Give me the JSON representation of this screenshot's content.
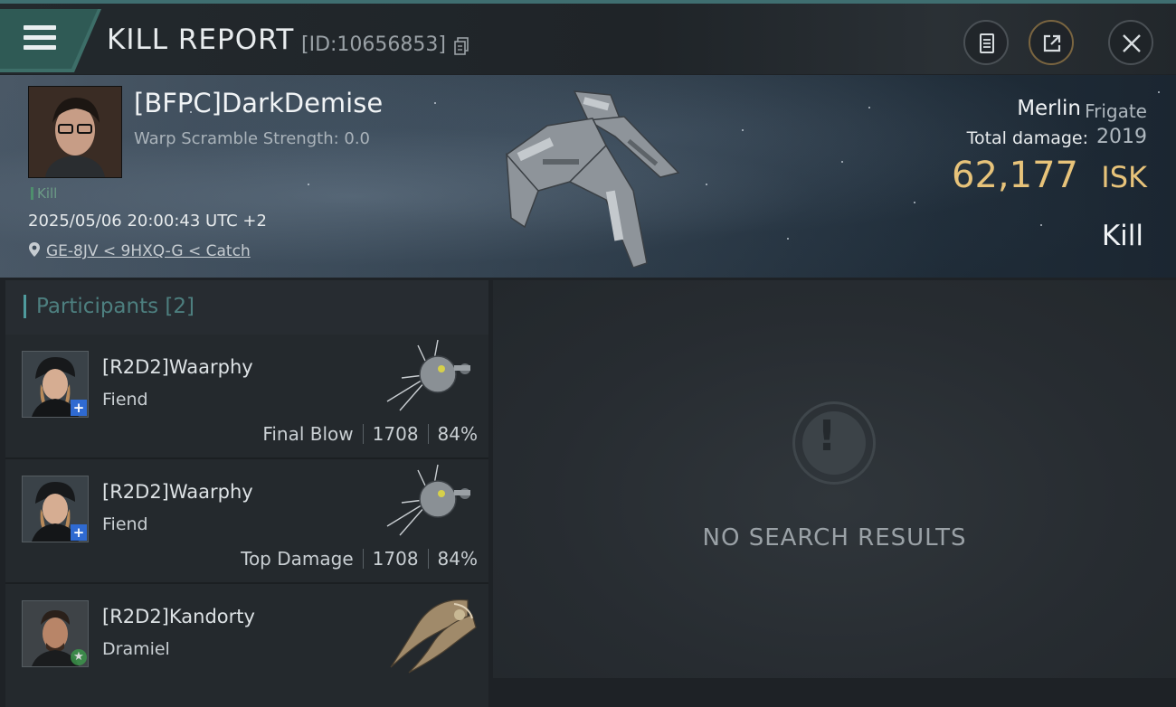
{
  "header": {
    "title": "KILL REPORT",
    "report_id": "[ID:10656853]"
  },
  "victim": {
    "name": "[BFPC]DarkDemise",
    "warp_scramble": "Warp Scramble Strength: 0.0",
    "tag": "Kill",
    "datetime": "2025/05/06 20:00:43 UTC +2",
    "location": "GE-8JV < 9HXQ-G < Catch",
    "ship_name": "Merlin",
    "ship_class": "Frigate",
    "damage_label": "Total damage:",
    "damage_value": "2019",
    "isk_value": "62,177",
    "isk_unit": "ISK",
    "result": "Kill"
  },
  "participants": {
    "title": "Participants [2]",
    "rows": [
      {
        "name": "[R2D2]Waarphy",
        "ship": "Fiend",
        "stat_label": "Final Blow",
        "damage": "1708",
        "percent": "84%",
        "badge": "+"
      },
      {
        "name": "[R2D2]Waarphy",
        "ship": "Fiend",
        "stat_label": "Top Damage",
        "damage": "1708",
        "percent": "84%",
        "badge": "+"
      },
      {
        "name": "[R2D2]Kandorty",
        "ship": "Dramiel",
        "stat_label": "",
        "damage": "",
        "percent": "",
        "badge": "★"
      }
    ]
  },
  "empty_state": {
    "icon": "!",
    "text": "NO SEARCH RESULTS"
  },
  "colors": {
    "accent": "#4f9b9d",
    "isk": "#e7c37a"
  }
}
